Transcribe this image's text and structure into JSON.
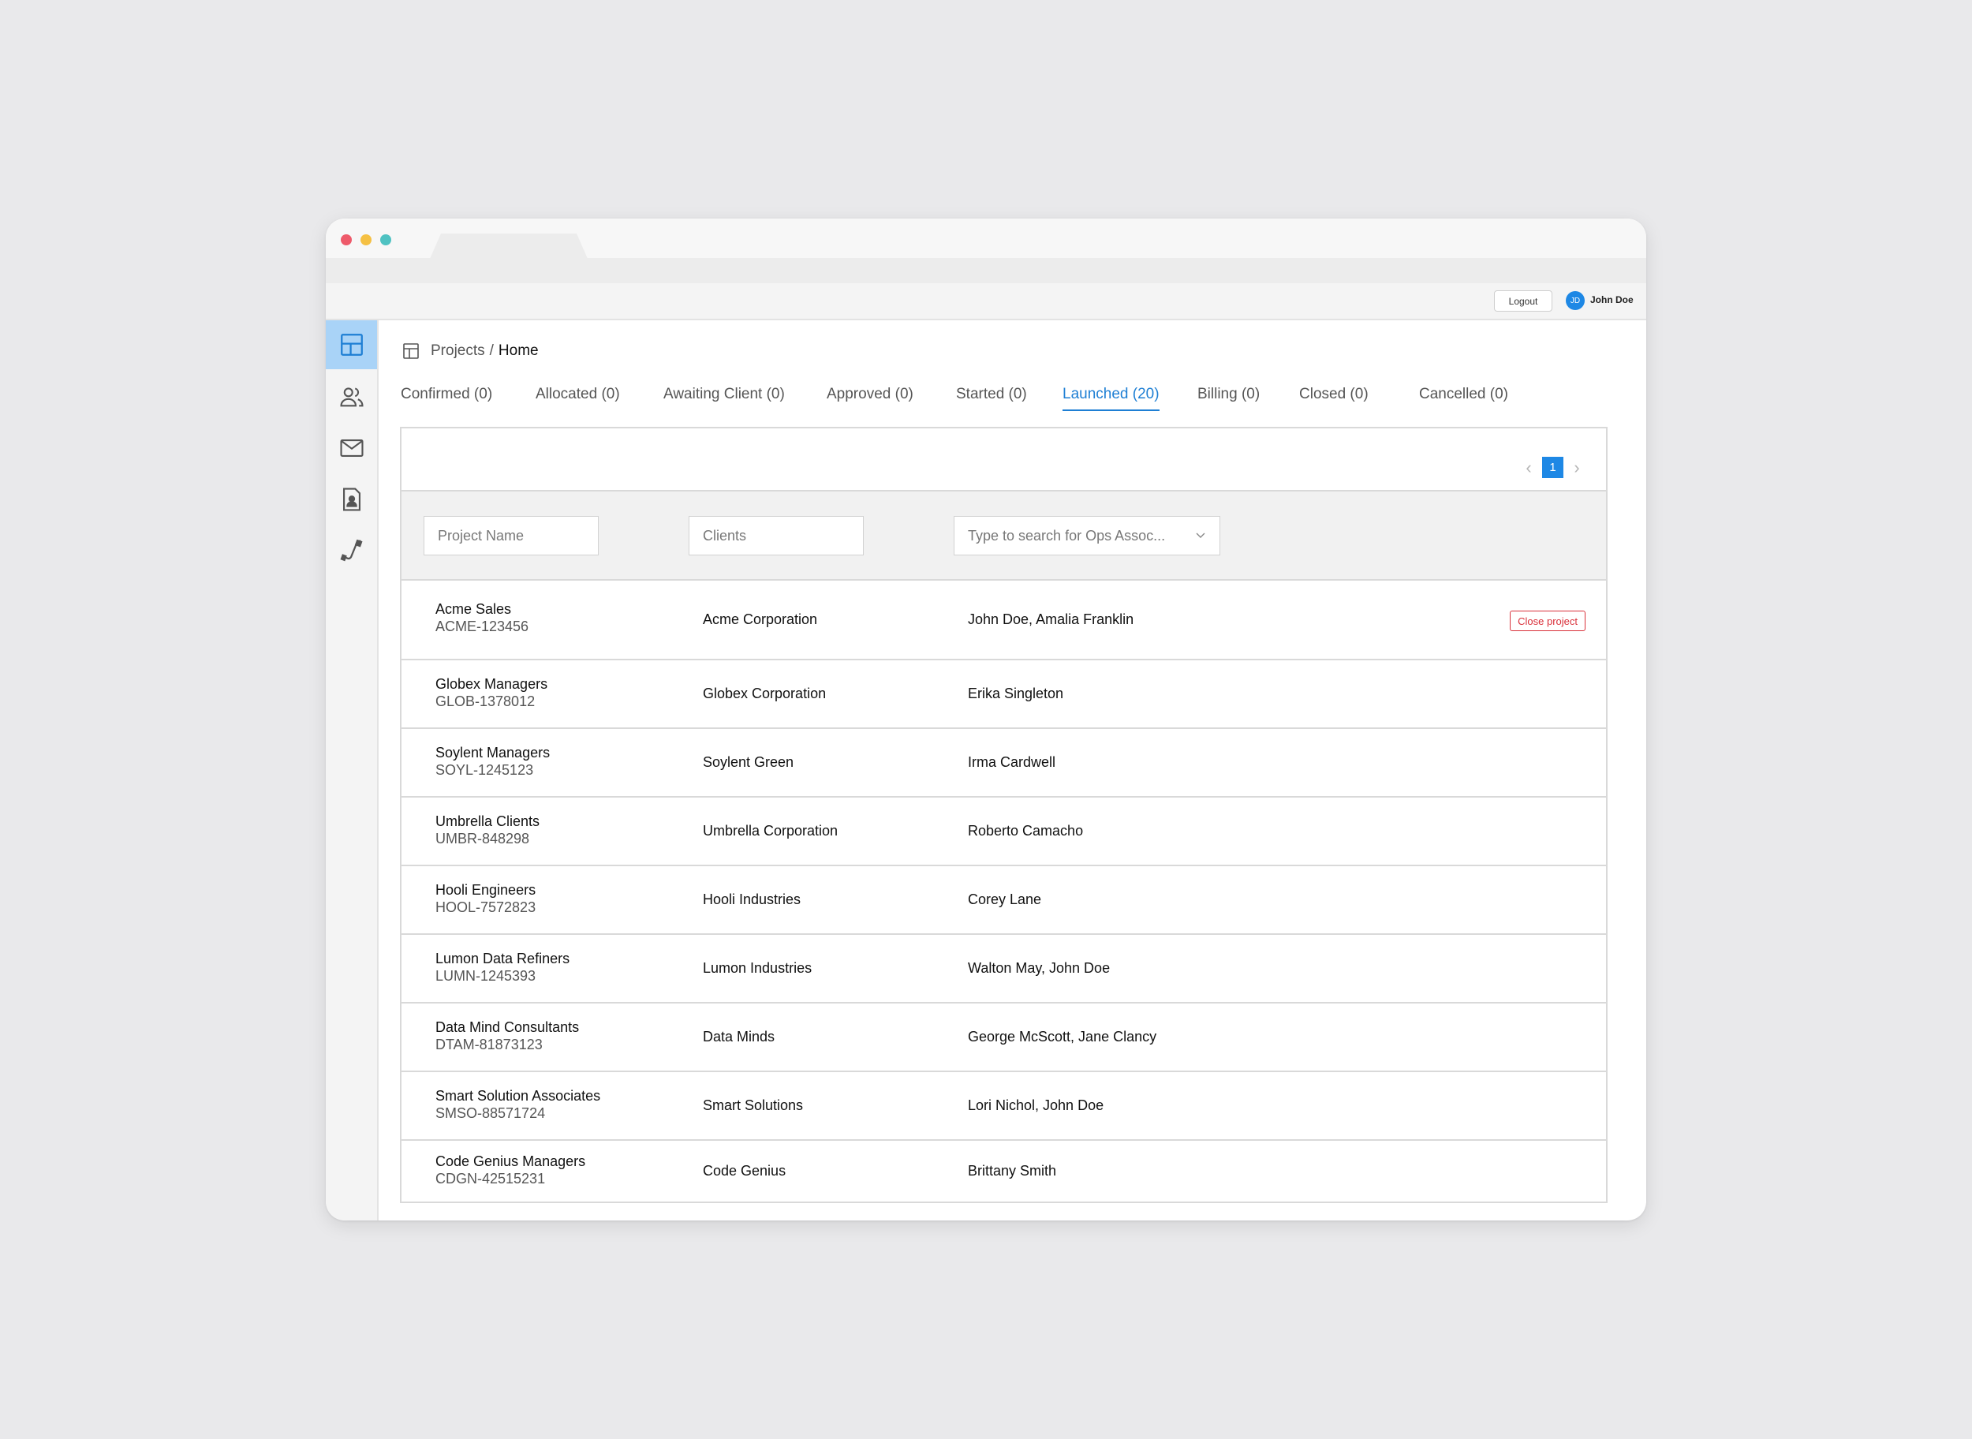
{
  "header": {
    "logout_label": "Logout",
    "avatar_initials": "JD",
    "user_name": "John Doe"
  },
  "sidebar": {
    "items": [
      {
        "icon": "dashboard-icon",
        "active": true
      },
      {
        "icon": "users-icon",
        "active": false
      },
      {
        "icon": "mail-icon",
        "active": false
      },
      {
        "icon": "contact-document-icon",
        "active": false
      },
      {
        "icon": "phone-icon",
        "active": false
      }
    ]
  },
  "breadcrumb": {
    "section": "Projects",
    "separator": "/",
    "current": "Home"
  },
  "tabs": [
    {
      "label": "Confirmed (0)",
      "active": false
    },
    {
      "label": "Allocated (0)",
      "active": false
    },
    {
      "label": "Awaiting Client (0)",
      "active": false
    },
    {
      "label": "Approved (0)",
      "active": false
    },
    {
      "label": "Started (0)",
      "active": false
    },
    {
      "label": "Launched (20)",
      "active": true
    },
    {
      "label": "Billing (0)",
      "active": false
    },
    {
      "label": "Closed (0)",
      "active": false
    },
    {
      "label": "Cancelled (0)",
      "active": false
    }
  ],
  "pagination": {
    "current_page": "1",
    "prev_icon": "‹",
    "next_icon": "›"
  },
  "filters": {
    "project_name_placeholder": "Project Name",
    "clients_placeholder": "Clients",
    "ops_placeholder": "Type to search for Ops Assoc..."
  },
  "close_project_label": "Close project",
  "projects": [
    {
      "name": "Acme Sales",
      "code": "ACME-123456",
      "client": "Acme Corporation",
      "ops": "John Doe, Amalia Franklin",
      "show_close": true
    },
    {
      "name": "Globex Managers",
      "code": "GLOB-1378012",
      "client": "Globex Corporation",
      "ops": "Erika Singleton",
      "show_close": false
    },
    {
      "name": "Soylent Managers",
      "code": "SOYL-1245123",
      "client": "Soylent Green",
      "ops": "Irma Cardwell",
      "show_close": false
    },
    {
      "name": "Umbrella Clients",
      "code": "UMBR-848298",
      "client": "Umbrella Corporation",
      "ops": "Roberto Camacho",
      "show_close": false
    },
    {
      "name": "Hooli Engineers",
      "code": "HOOL-7572823",
      "client": "Hooli Industries",
      "ops": "Corey Lane",
      "show_close": false
    },
    {
      "name": "Lumon Data Refiners",
      "code": "LUMN-1245393",
      "client": "Lumon Industries",
      "ops": "Walton May, John Doe",
      "show_close": false
    },
    {
      "name": "Data Mind Consultants",
      "code": "DTAM-81873123",
      "client": "Data Minds",
      "ops": "George McScott, Jane Clancy",
      "show_close": false
    },
    {
      "name": "Smart Solution Associates",
      "code": "SMSO-88571724",
      "client": "Smart Solutions",
      "ops": "Lori Nichol, John Doe",
      "show_close": false
    },
    {
      "name": "Code Genius Managers",
      "code": "CDGN-42515231",
      "client": "Code Genius",
      "ops": "Brittany Smith",
      "show_close": false
    }
  ],
  "colors": {
    "accent": "#1e88e5",
    "active_tab": "#1e7fd4",
    "danger": "#d9303a",
    "sidebar_active": "#a9d3f7"
  }
}
